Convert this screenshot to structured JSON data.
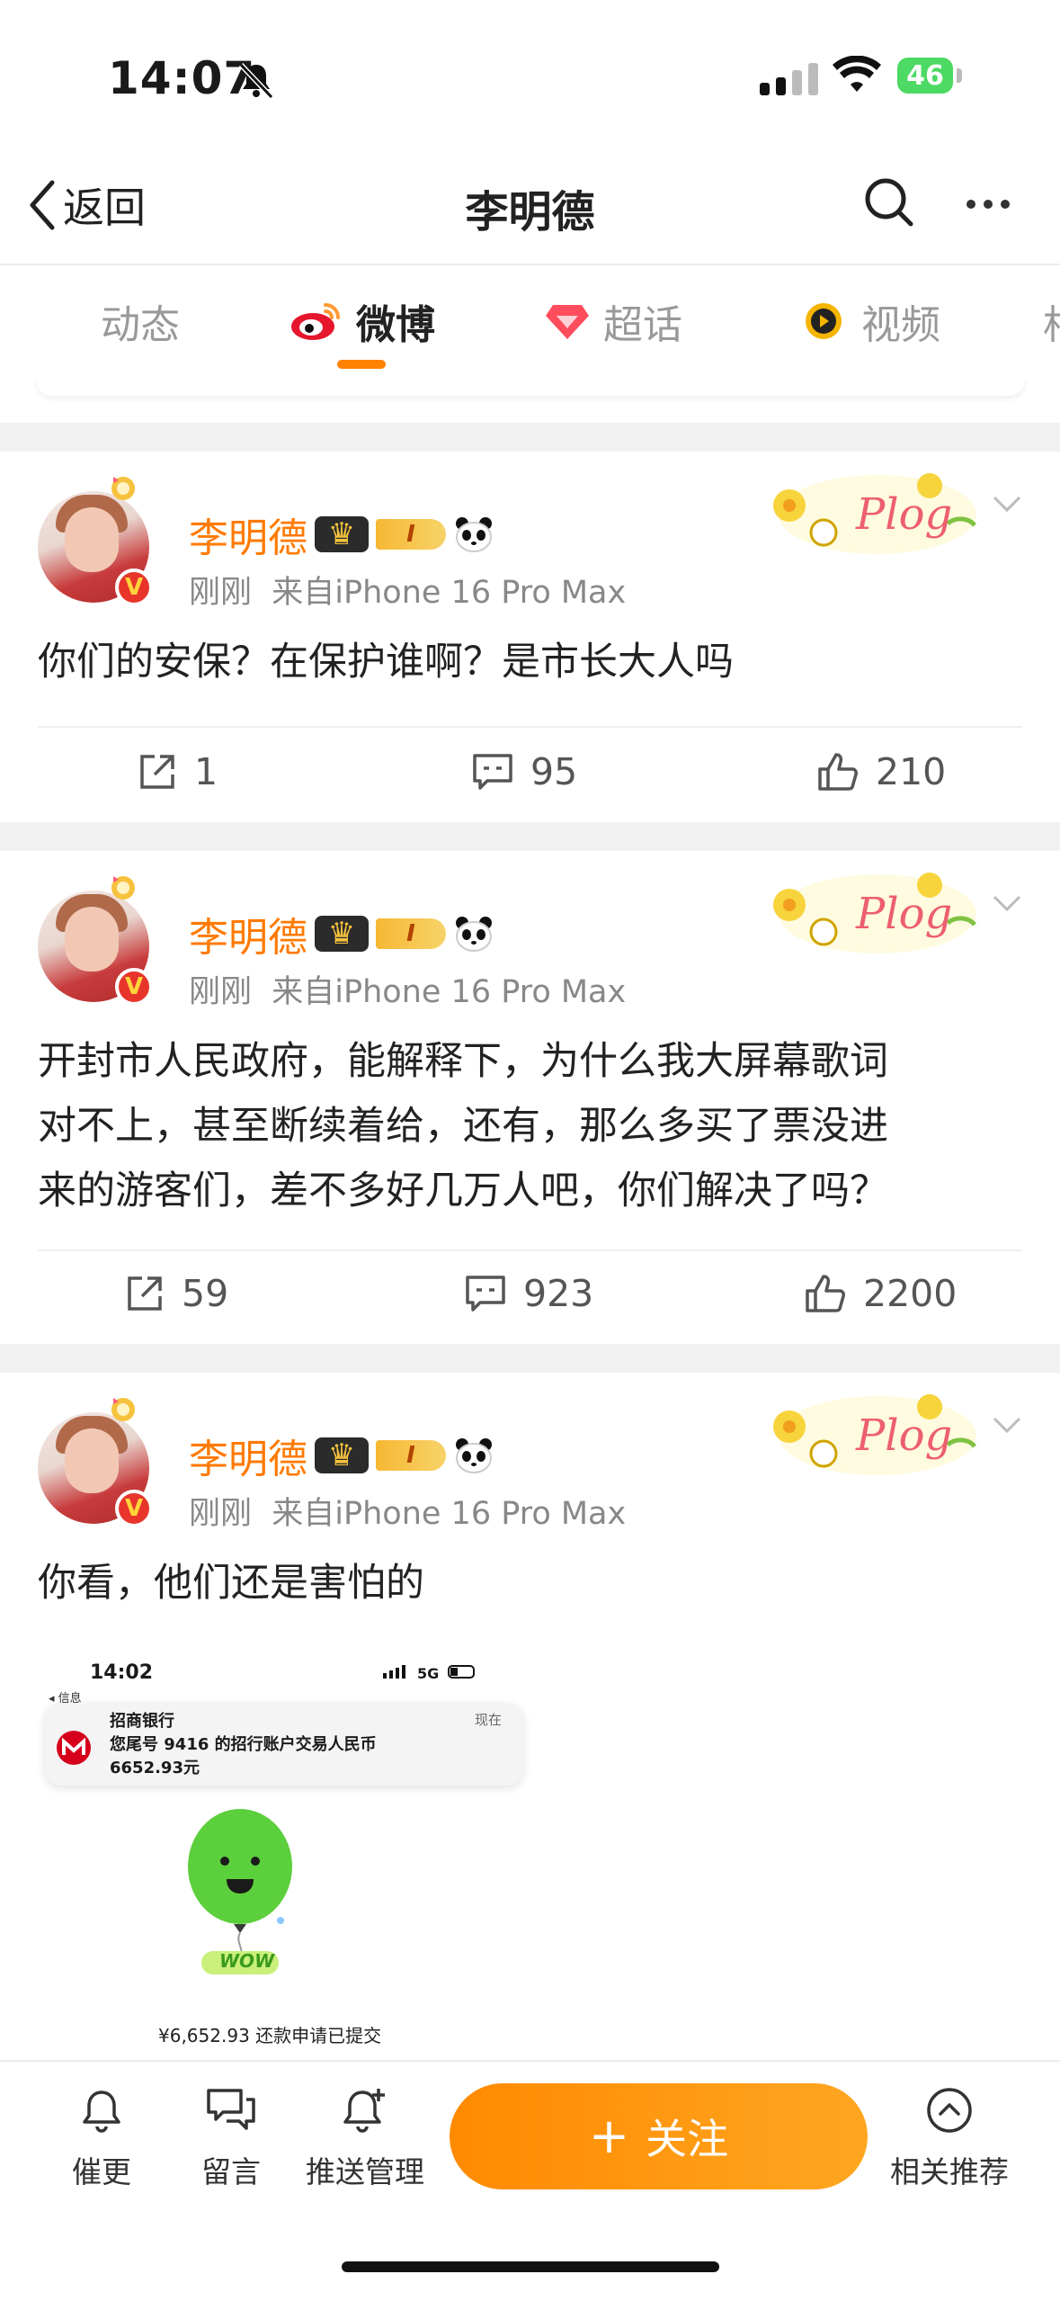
{
  "status_bar": {
    "time": "14:07",
    "battery": "46"
  },
  "nav": {
    "back_label": "返回",
    "title": "李明德"
  },
  "tabs": [
    {
      "label": "动态"
    },
    {
      "label": "微博"
    },
    {
      "label": "超话"
    },
    {
      "label": "视频"
    },
    {
      "label": "相"
    }
  ],
  "posts": [
    {
      "author": "李明德",
      "time": "刚刚",
      "source": "来自iPhone 16 Pro Max",
      "level": "I",
      "sticker": "Plog",
      "text": "你们的安保？在保护谁啊？是市长大人吗",
      "reposts": "1",
      "comments": "95",
      "likes": "210"
    },
    {
      "author": "李明德",
      "time": "刚刚",
      "source": "来自iPhone 16 Pro Max",
      "level": "I",
      "sticker": "Plog",
      "text_lines": [
        "开封市人民政府，能解释下，为什么我大屏幕歌词",
        "对不上，甚至断续着给，还有，那么多买了票没进",
        "来的游客们，差不多好几万人吧，你们解决了吗？"
      ],
      "reposts": "59",
      "comments": "923",
      "likes": "2200"
    },
    {
      "author": "李明德",
      "time": "刚刚",
      "source": "来自iPhone 16 Pro Max",
      "level": "I",
      "sticker": "Plog",
      "text": "你看，他们还是害怕的",
      "embedded_image": {
        "time": "14:02",
        "back": "◂ 信息",
        "network": "5G",
        "notif_bank": "招商银行",
        "notif_time": "现在",
        "notif_line1": "您尾号 9416 的招行账户交易人民币",
        "notif_line2": "6652.93元",
        "balloon_text": "WOW",
        "caption": "¥6,652.93 还款申请已提交"
      }
    }
  ],
  "bottom_bar": {
    "remind": "催更",
    "message": "留言",
    "push": "推送管理",
    "follow": "关注",
    "follow_plus": "+",
    "related": "相关推荐"
  },
  "colors": {
    "accent": "#ff8200",
    "name": "#ff7a00",
    "meta": "#888888"
  }
}
